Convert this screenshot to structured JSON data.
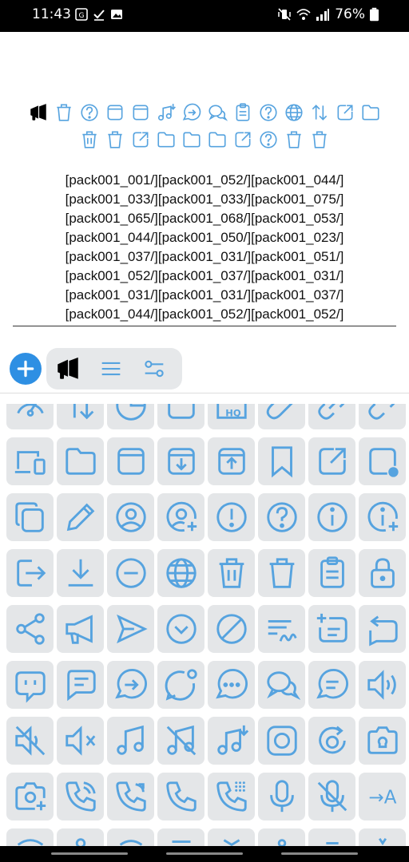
{
  "status": {
    "time": "11:43",
    "battery": "76%"
  },
  "emoji_rows": [
    [
      "megaphone-black",
      "trash",
      "question",
      "square",
      "square",
      "music-add",
      "arrow-right-circle",
      "chat",
      "clipboard",
      "question",
      "globe",
      "arrows-updown",
      "external",
      "folder"
    ],
    [
      "trash2",
      "trash",
      "external",
      "folder",
      "folder",
      "folder",
      "external",
      "question",
      "trash",
      "trash"
    ]
  ],
  "text_lines": [
    "[pack001_001/][pack001_052/][pack001_044/]",
    "[pack001_033/][pack001_033/][pack001_075/]",
    "[pack001_065/][pack001_068/][pack001_053/]",
    "[pack001_044/][pack001_050/][pack001_023/]",
    "[pack001_037/][pack001_031/][pack001_051/]",
    "[pack001_052/][pack001_037/][pack001_031/]",
    "[pack001_031/][pack001_031/][pack001_037/]",
    "[pack001_044/][pack001_052/][pack001_052/]"
  ],
  "toolbar": {
    "tabs": [
      "megaphone-tab",
      "menu-tab",
      "settings-tab"
    ]
  },
  "grid": {
    "hq_label": "HQ",
    "translate_label": "→A",
    "icons": [
      "gauge",
      "arrows-updown",
      "pie",
      "square-corner",
      "folder-hq",
      "paperclip",
      "link",
      "link-broken",
      "devices",
      "folder",
      "square",
      "archive-down",
      "archive-up",
      "bookmark",
      "external",
      "square-dot",
      "copy",
      "pencil",
      "user-circle",
      "user-add",
      "exclaim-circle",
      "question-circle",
      "info-circle",
      "info-add",
      "logout",
      "download",
      "minus-circle",
      "globe",
      "trash",
      "trash2",
      "clipboard",
      "lock",
      "share",
      "megaphone",
      "send",
      "chevron-down-circle",
      "block",
      "sign",
      "text-add",
      "repeat",
      "chat-bot",
      "chat-lines",
      "chat-arrow",
      "chat-dot",
      "chat-more",
      "chats",
      "chat-circle",
      "volume",
      "volume-off",
      "volume-x",
      "music",
      "music-off",
      "music-add",
      "record",
      "refresh-circle",
      "camera-bulb",
      "camera-add",
      "phone-in",
      "phone-out",
      "phone",
      "phone-dialpad",
      "mic",
      "mic-off",
      "translate",
      "row9a",
      "row9b",
      "row9c",
      "row9d",
      "row9e",
      "row9f",
      "row9g",
      "row9h"
    ]
  },
  "colors": {
    "icon": "#56a3df",
    "accent": "#2e8fe3",
    "cell": "#e4e6e8",
    "text": "#111111"
  }
}
